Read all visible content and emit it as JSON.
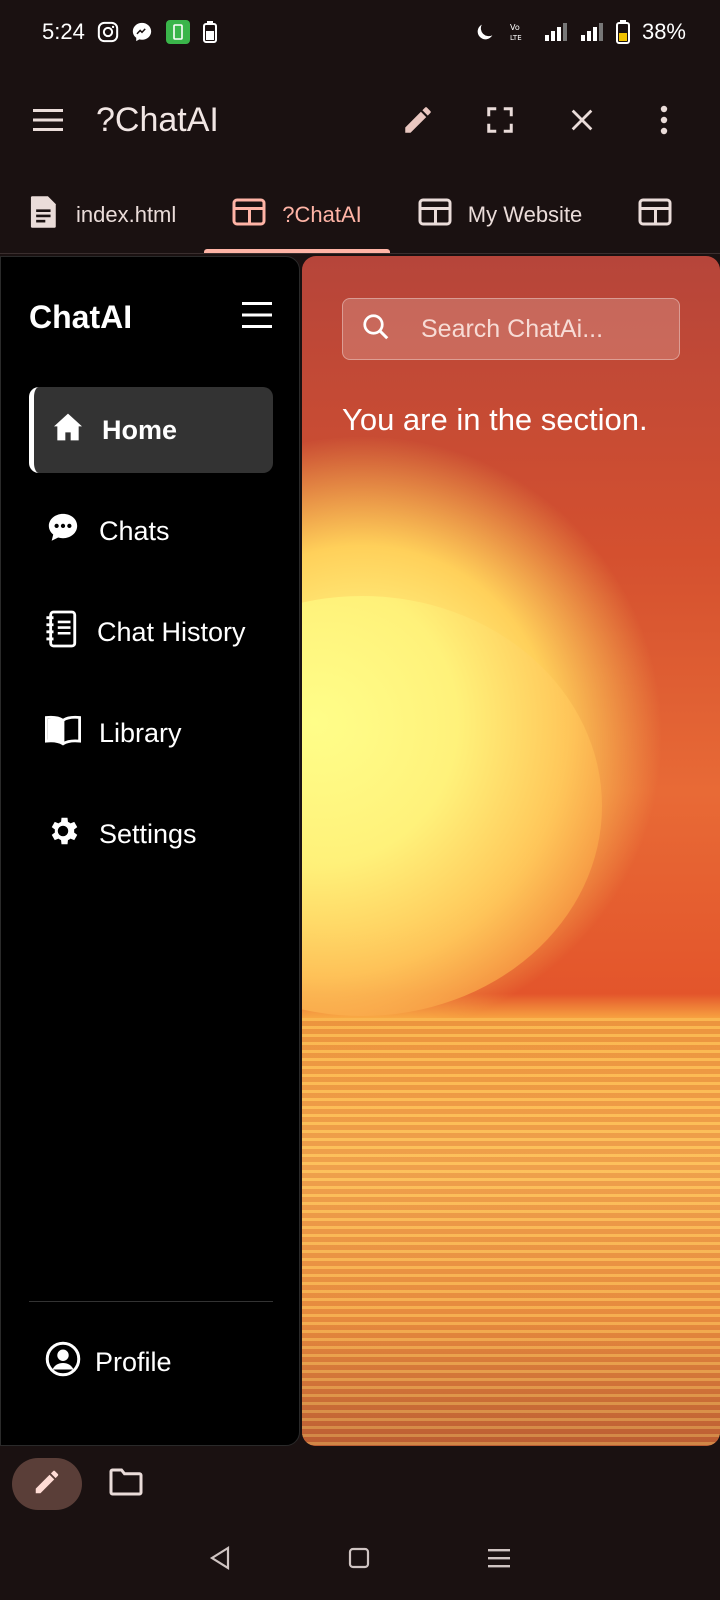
{
  "status_bar": {
    "time": "5:24",
    "battery_percent": "38%",
    "left_icons": [
      "instagram-icon",
      "messenger-icon",
      "app-badge-icon",
      "battery-small-icon"
    ],
    "right_icons": [
      "moon-icon",
      "volte-icon",
      "signal-icon",
      "signal-icon",
      "battery-icon"
    ],
    "volte_label": "Vo LTE"
  },
  "app_bar": {
    "title": "?ChatAI",
    "actions": [
      "pencil-icon",
      "fullscreen-icon",
      "close-icon",
      "more-vert-icon"
    ]
  },
  "tabs": [
    {
      "label": "index.html",
      "icon": "document-icon",
      "active": false
    },
    {
      "label": "?ChatAI",
      "icon": "web-icon",
      "active": true
    },
    {
      "label": "My Website",
      "icon": "web-icon",
      "active": false
    }
  ],
  "sidebar": {
    "brand": "ChatAI",
    "nav": [
      {
        "label": "Home",
        "icon": "home-icon",
        "active": true
      },
      {
        "label": "Chats",
        "icon": "chat-bubble-icon",
        "active": false
      },
      {
        "label": "Chat History",
        "icon": "history-notebook-icon",
        "active": false
      },
      {
        "label": "Library",
        "icon": "book-icon",
        "active": false
      },
      {
        "label": "Settings",
        "icon": "gear-icon",
        "active": false
      }
    ],
    "profile_label": "Profile"
  },
  "main": {
    "search_placeholder": "Search ChatAi...",
    "section_message": "You are in the section."
  },
  "colors": {
    "accent": "#ffb4a6",
    "sidebar_bg": "#000000",
    "active_nav_bg": "#333333",
    "app_bg": "#1a1111"
  }
}
